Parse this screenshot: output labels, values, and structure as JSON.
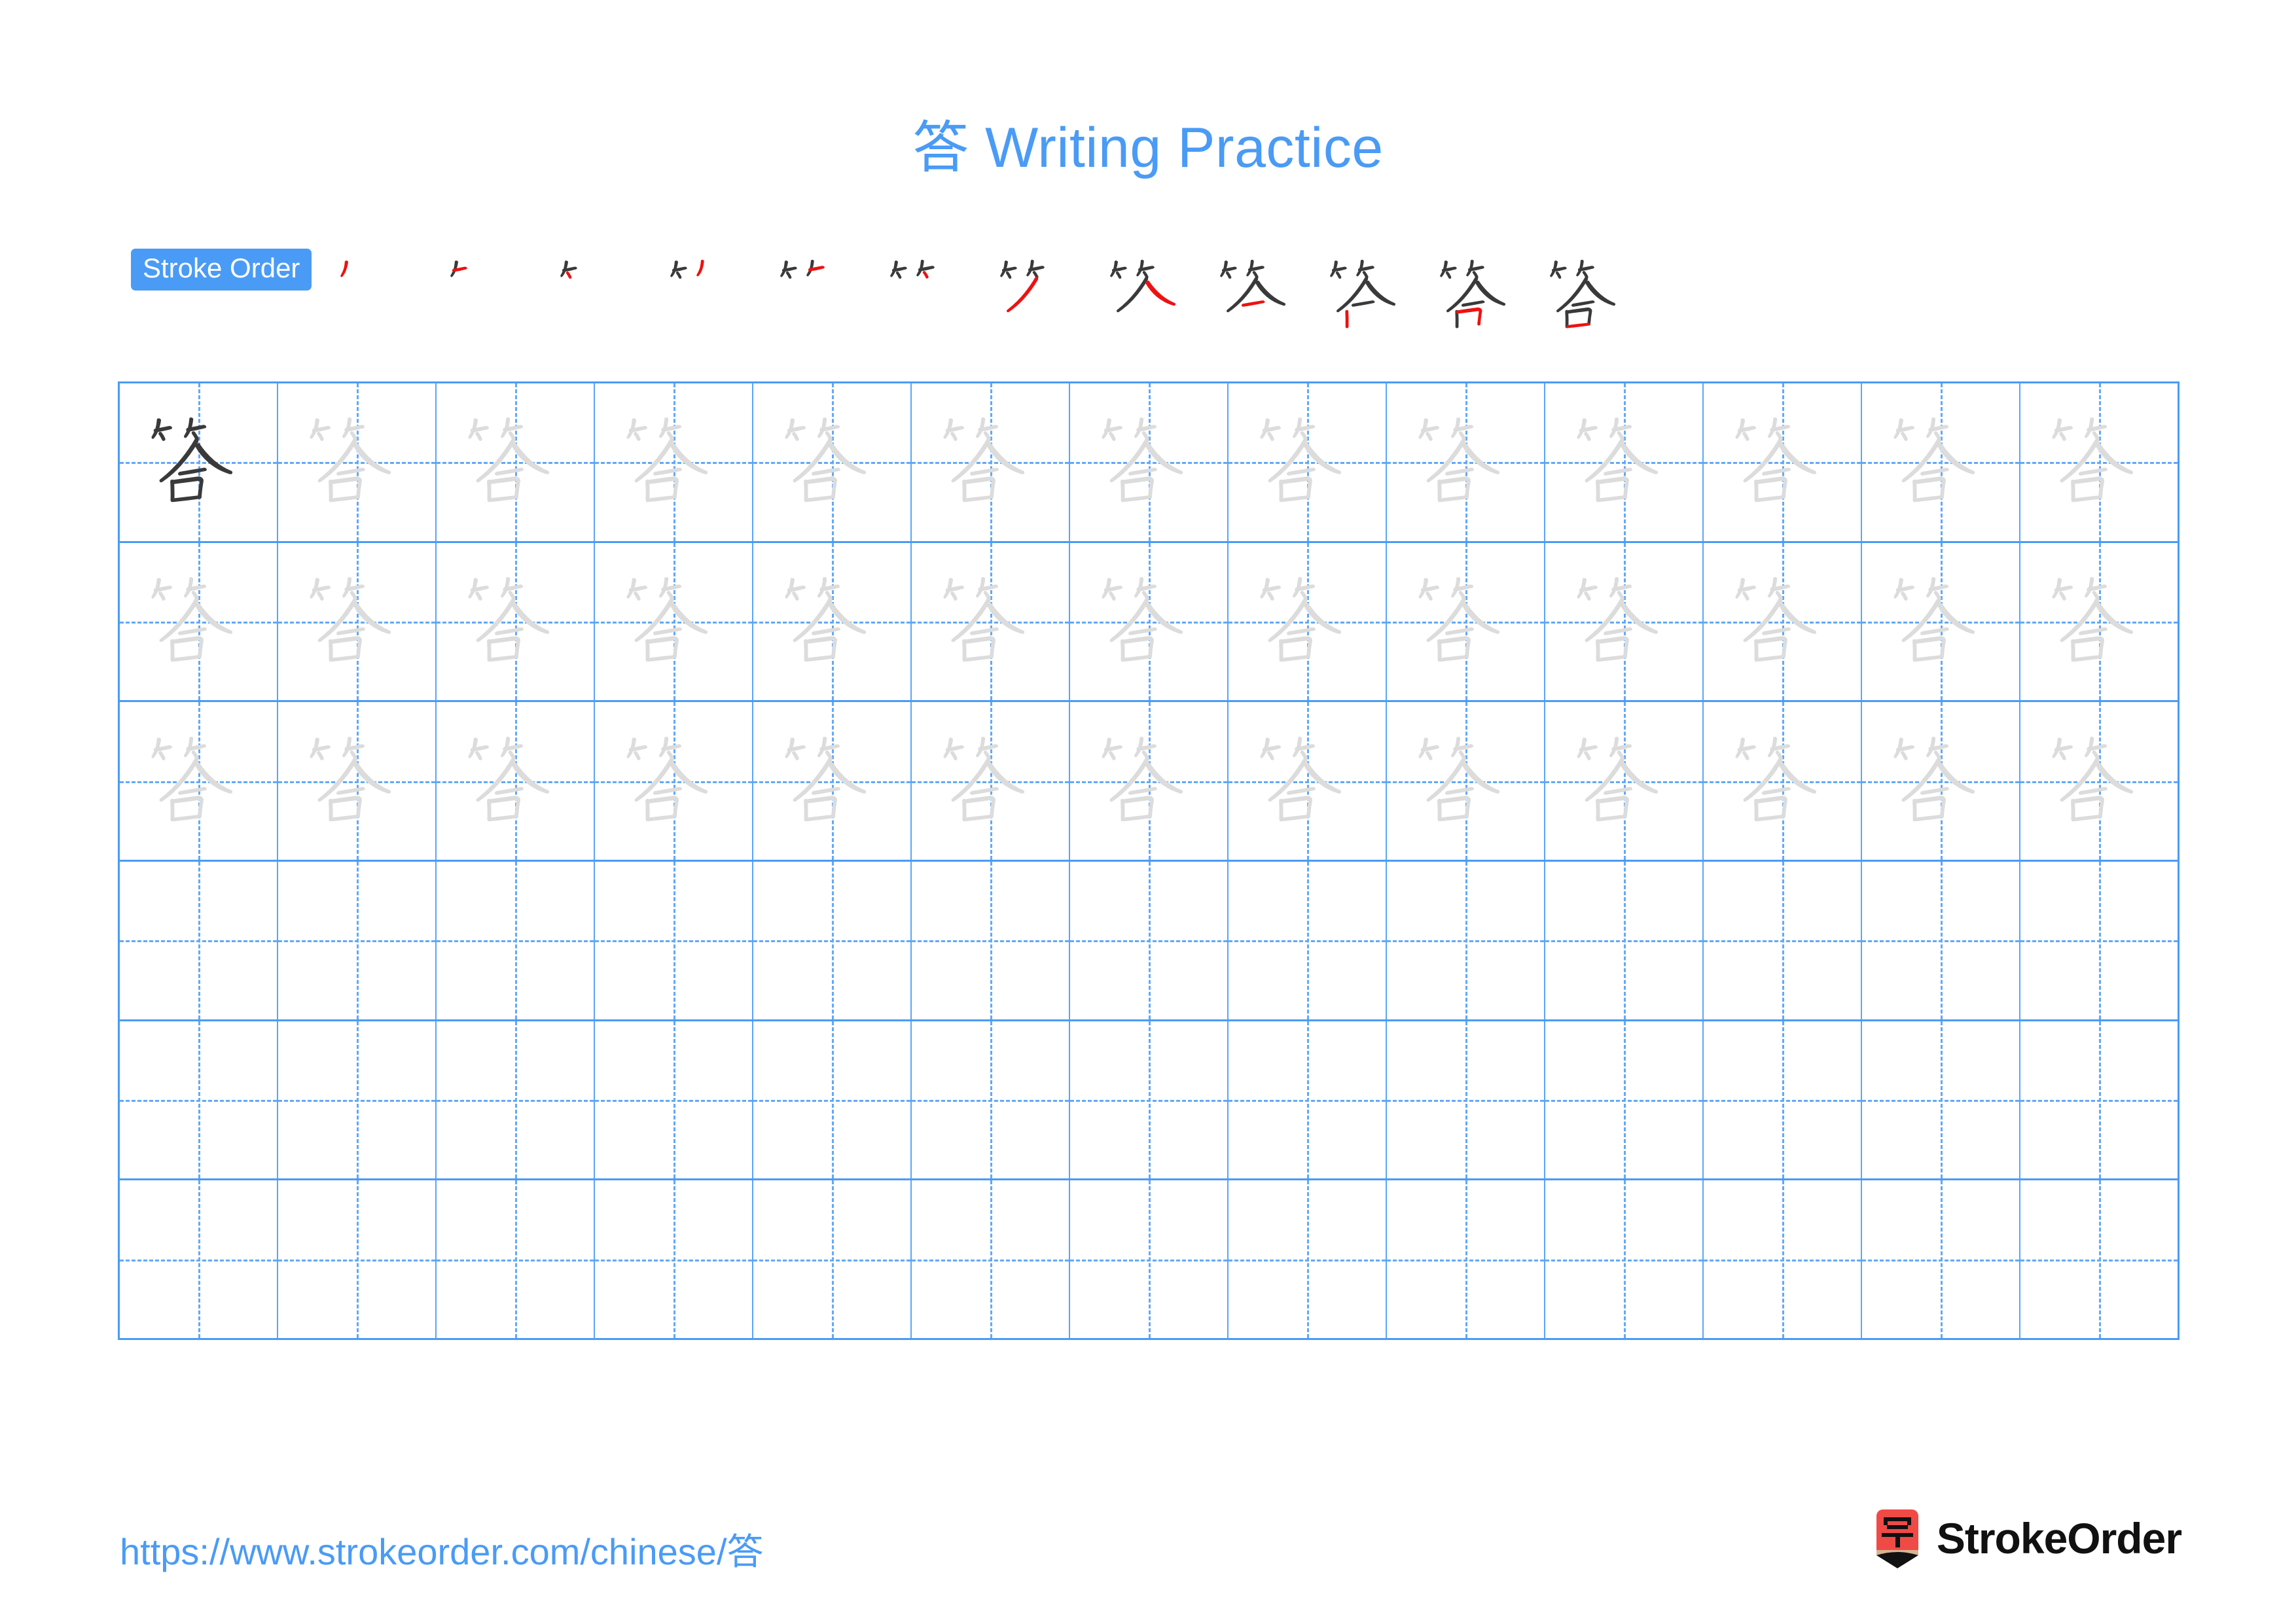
{
  "page": {
    "title": "答 Writing Practice",
    "character": "答",
    "background_color": "#ffffff",
    "accent_color": "#4A9BF5",
    "model_char_color": "#3A3A3A",
    "trace_char_color": "#DCDCDC",
    "highlight_stroke_color": "#EE1111"
  },
  "stroke_order": {
    "badge_label": "Stroke Order",
    "total_strokes": 12,
    "steps": [
      {
        "index": 1,
        "strokes_shown": 1
      },
      {
        "index": 2,
        "strokes_shown": 2
      },
      {
        "index": 3,
        "strokes_shown": 3
      },
      {
        "index": 4,
        "strokes_shown": 4
      },
      {
        "index": 5,
        "strokes_shown": 5
      },
      {
        "index": 6,
        "strokes_shown": 6
      },
      {
        "index": 7,
        "strokes_shown": 7
      },
      {
        "index": 8,
        "strokes_shown": 8
      },
      {
        "index": 9,
        "strokes_shown": 9
      },
      {
        "index": 10,
        "strokes_shown": 10
      },
      {
        "index": 11,
        "strokes_shown": 11
      },
      {
        "index": 12,
        "strokes_shown": 12
      }
    ]
  },
  "grid": {
    "columns": 13,
    "rows": 6,
    "row_types": [
      "model-then-trace",
      "trace",
      "trace",
      "blank",
      "blank",
      "blank"
    ],
    "border_color": "#4A9BF5",
    "guide_color": "#62A9F8"
  },
  "footer": {
    "url": "https://www.strokeorder.com/chinese/答",
    "brand_name": "StrokeOrder",
    "brand_icon_char": "字",
    "brand_icon_color": "#F04A47"
  }
}
